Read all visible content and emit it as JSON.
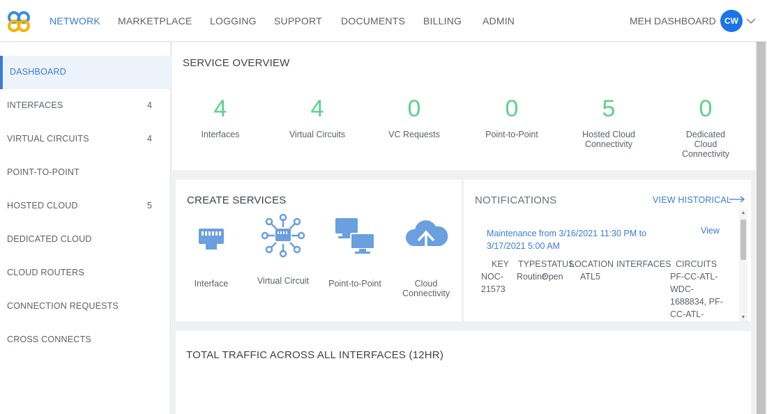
{
  "nav": {
    "items": [
      "NETWORK",
      "MARKETPLACE",
      "LOGGING",
      "SUPPORT",
      "DOCUMENTS",
      "BILLING",
      "ADMIN"
    ],
    "active": "NETWORK",
    "dashboard_label": "MEH DASHBOARD",
    "avatar_initials": "CW"
  },
  "sidebar": {
    "items": [
      {
        "label": "DASHBOARD",
        "count": ""
      },
      {
        "label": "INTERFACES",
        "count": "4"
      },
      {
        "label": "VIRTUAL CIRCUITS",
        "count": "4"
      },
      {
        "label": "POINT-TO-POINT",
        "count": ""
      },
      {
        "label": "HOSTED CLOUD",
        "count": "5"
      },
      {
        "label": "DEDICATED CLOUD",
        "count": ""
      },
      {
        "label": "CLOUD ROUTERS",
        "count": ""
      },
      {
        "label": "CONNECTION REQUESTS",
        "count": ""
      },
      {
        "label": "CROSS CONNECTS",
        "count": ""
      }
    ]
  },
  "overview": {
    "title": "SERVICE OVERVIEW",
    "stats": [
      {
        "value": "4",
        "label": "Interfaces"
      },
      {
        "value": "4",
        "label": "Virtual Circuits"
      },
      {
        "value": "0",
        "label": "VC Requests"
      },
      {
        "value": "0",
        "label": "Point-to-Point"
      },
      {
        "value": "5",
        "label": "Hosted Cloud Connectivity"
      },
      {
        "value": "0",
        "label": "Dedicated Cloud Connectivity"
      }
    ]
  },
  "create_services": {
    "title": "CREATE SERVICES",
    "items": [
      {
        "label": "Interface",
        "icon": "ethernet-port-icon"
      },
      {
        "label": "Virtual Circuit",
        "icon": "virtual-circuit-icon"
      },
      {
        "label": "Point-to-Point",
        "icon": "point-to-point-icon"
      },
      {
        "label": "Cloud Connectivity",
        "icon": "cloud-upload-icon"
      }
    ]
  },
  "notifications": {
    "title": "NOTIFICATIONS",
    "view_historical": "VIEW HISTORICAL",
    "item": {
      "title": "Maintenance from 3/16/2021 11:30 PM to 3/17/2021 5:00 AM",
      "view": "View",
      "headers": [
        "KEY",
        "TYPE",
        "STATUS",
        "LOCATION",
        "INTERFACES",
        "CIRCUITS"
      ],
      "row": {
        "key": "NOC-21573",
        "type": "Routine",
        "status": "Open",
        "location": "ATL5",
        "interfaces": "",
        "circuits": "PF-CC-ATL-WDC-1688834, PF-CC-ATL-"
      }
    }
  },
  "traffic": {
    "title": "TOTAL TRAFFIC ACROSS ALL INTERFACES (12HR)"
  },
  "colors": {
    "accent": "#3a7bd5",
    "stat_green": "#5dd18b",
    "icon_blue": "#6a9fe0",
    "avatar": "#1a73e8",
    "logo_blue": "#3d8be8",
    "logo_yellow": "#f5b400"
  }
}
